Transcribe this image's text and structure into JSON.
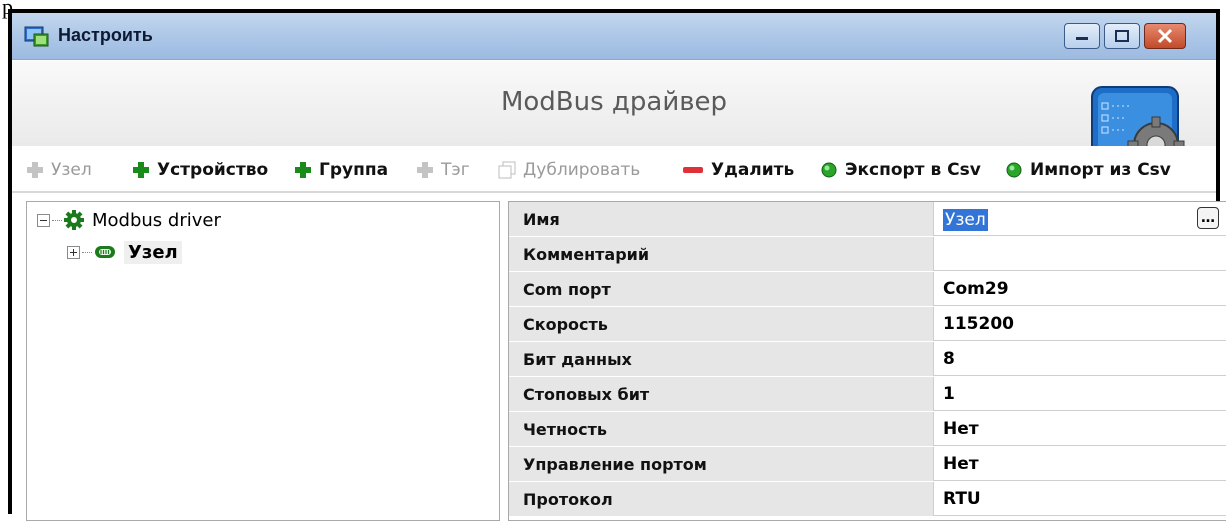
{
  "corner_glyph": "p",
  "window": {
    "title": "Настроить",
    "controls": {
      "minimize": "minimize-icon",
      "maximize": "maximize-icon",
      "close": "close-icon"
    }
  },
  "header": {
    "title": "ModBus драйвер"
  },
  "toolbar": [
    {
      "id": "node",
      "label": "Узел",
      "enabled": false,
      "icon": "plus-icon"
    },
    {
      "id": "device",
      "label": "Устройство",
      "enabled": true,
      "icon": "plus-icon"
    },
    {
      "id": "group",
      "label": "Группа",
      "enabled": true,
      "icon": "plus-icon"
    },
    {
      "id": "tag",
      "label": "Тэг",
      "enabled": false,
      "icon": "plus-icon"
    },
    {
      "id": "duplicate",
      "label": "Дублировать",
      "enabled": false,
      "icon": "duplicate-icon"
    },
    {
      "id": "delete",
      "label": "Удалить",
      "enabled": true,
      "icon": "minus-icon"
    },
    {
      "id": "export",
      "label": "Экспорт в Csv",
      "enabled": true,
      "icon": "green-dot-icon"
    },
    {
      "id": "import",
      "label": "Импорт из Csv",
      "enabled": true,
      "icon": "green-dot-icon"
    }
  ],
  "tree": {
    "root": {
      "label": "Modbus driver",
      "icon": "gear-icon",
      "expanded": true
    },
    "children": [
      {
        "label": "Узел",
        "icon": "port-icon",
        "expanded": false,
        "selected": true
      }
    ]
  },
  "properties": [
    {
      "name": "Имя",
      "value": "Узел",
      "editing": true
    },
    {
      "name": "Комментарий",
      "value": ""
    },
    {
      "name": "Com порт",
      "value": "Com29"
    },
    {
      "name": "Скорость",
      "value": "115200"
    },
    {
      "name": "Бит данных",
      "value": "8"
    },
    {
      "name": "Стоповых бит",
      "value": "1"
    },
    {
      "name": "Четность",
      "value": "Нет"
    },
    {
      "name": "Управление портом",
      "value": "Нет"
    },
    {
      "name": "Протокол",
      "value": "RTU"
    }
  ],
  "colors": {
    "accent_green": "#1a8a1a",
    "delete_red": "#e0303a",
    "selection_blue": "#3275d6"
  }
}
